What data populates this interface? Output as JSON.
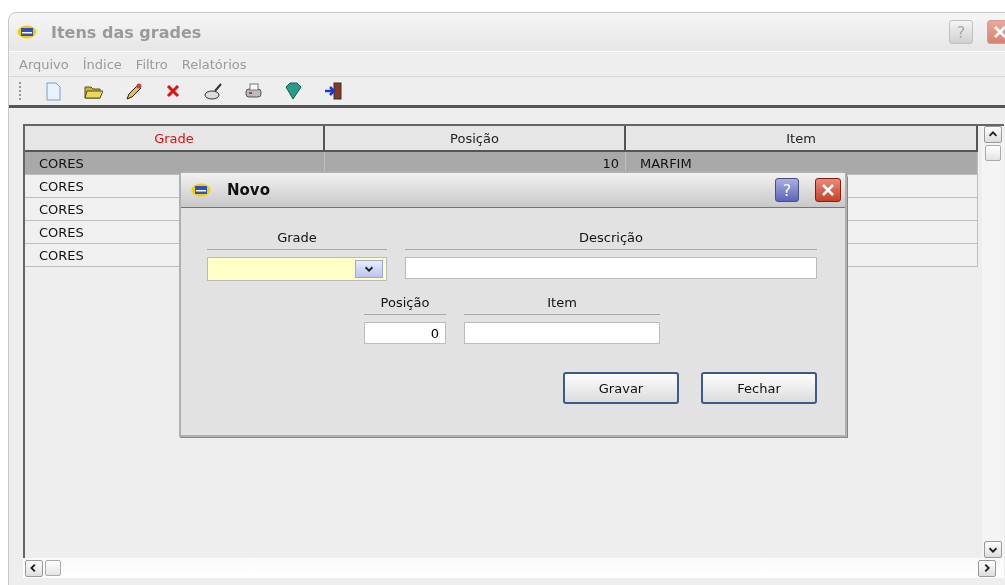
{
  "window": {
    "title": "Itens das grades",
    "help": "?"
  },
  "menu": [
    {
      "label": "Arquivo"
    },
    {
      "label": "Índice"
    },
    {
      "label": "Filtro"
    },
    {
      "label": "Relatórios"
    }
  ],
  "toolbar": [
    {
      "kind": "new"
    },
    {
      "kind": "open"
    },
    {
      "kind": "edit"
    },
    {
      "kind": "delete"
    },
    {
      "kind": "search"
    },
    {
      "kind": "print"
    },
    {
      "kind": "filter"
    },
    {
      "kind": "exit"
    }
  ],
  "table": {
    "columns": [
      {
        "label": "Grade",
        "sorted": true
      },
      {
        "label": "Posição",
        "sorted": false
      },
      {
        "label": "Item",
        "sorted": false
      }
    ],
    "rows": [
      {
        "grade": "CORES",
        "posicao": "10",
        "item": "MARFIM",
        "selected": true
      },
      {
        "grade": "CORES",
        "selected": false
      },
      {
        "grade": "CORES",
        "selected": false
      },
      {
        "grade": "CORES",
        "selected": false
      },
      {
        "grade": "CORES",
        "selected": false
      }
    ]
  },
  "dialog": {
    "title": "Novo",
    "help": "?",
    "fields": {
      "grade": {
        "label": "Grade"
      },
      "descricao": {
        "label": "Descrição"
      },
      "posicao": {
        "label": "Posição",
        "value": "0"
      },
      "item": {
        "label": "Item"
      }
    },
    "buttons": [
      {
        "label": "Gravar"
      },
      {
        "label": "Fechar"
      }
    ]
  }
}
